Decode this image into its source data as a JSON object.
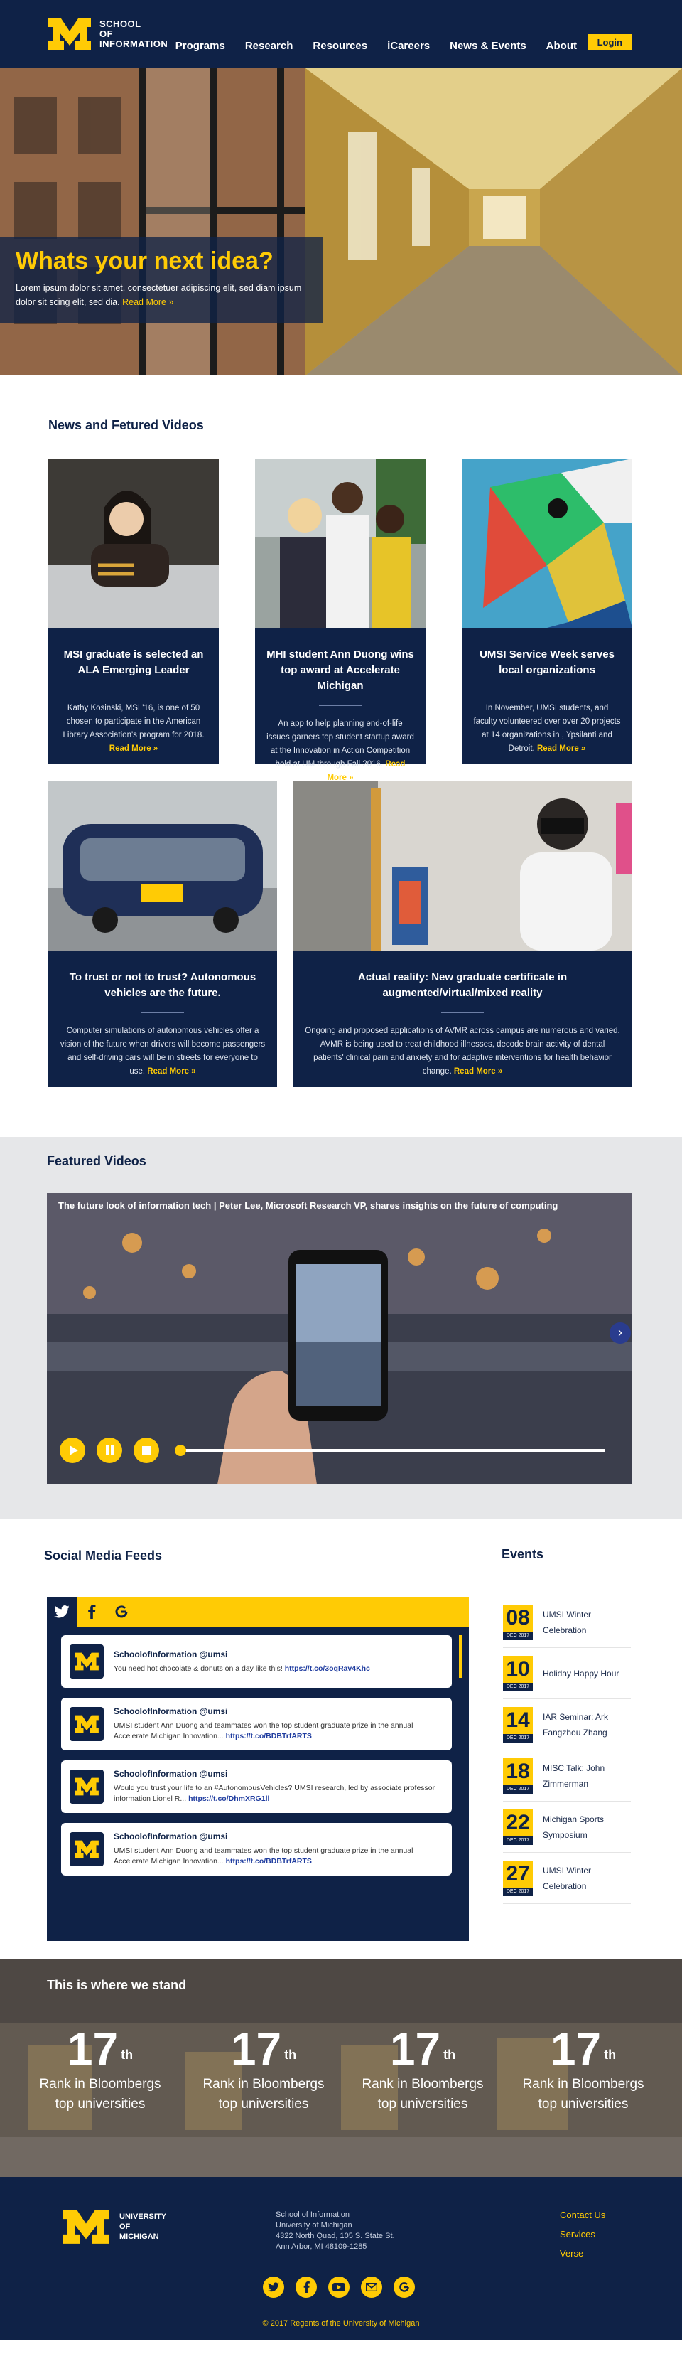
{
  "colors": {
    "navy": "#0f2247",
    "maize": "#ffcb05"
  },
  "brand": {
    "line1": "SCHOOL",
    "line2": "OF",
    "line3": "INFORMATION"
  },
  "nav": {
    "items": [
      "Programs",
      "Research",
      "Resources",
      "iCareers",
      "News & Events",
      "About"
    ],
    "login": "Login"
  },
  "hero": {
    "title": "Whats your next idea?",
    "text": "Lorem ipsum dolor sit amet, consectetuer adipiscing elit, sed diam ipsum dolor sit scing elit, sed dia.",
    "more": "Read More »"
  },
  "news": {
    "heading": "News and Fetured Videos",
    "more": "Read More »",
    "cards": [
      {
        "title": "MSI graduate is selected an ALA Emerging Leader",
        "text": "Kathy Kosinski, MSI '16, is one of 50 chosen to participate in the American Library Association's program for 2018."
      },
      {
        "title": "MHI student Ann Duong wins top award at Accelerate Michigan",
        "text": "An app to help planning end-of-life issues garners top student startup award at the Innovation in Action Competition held at UM through Fall 2016."
      },
      {
        "title": "UMSI Service Week serves local organizations",
        "text": "In November, UMSI students, and faculty volunteered over over 20 projects at 14 organizations in , Ypsilanti and Detroit."
      },
      {
        "title": "To trust or not to trust? Autonomous vehicles are the future.",
        "text": "Computer simulations of autonomous vehicles offer a vision of the future when drivers will become passengers and self-driving cars will be in streets for everyone to use."
      },
      {
        "title": "Actual reality: New graduate certificate in augmented/virtual/mixed reality",
        "text": "Ongoing and proposed applications of AVMR across campus are numerous and varied. AVMR is being used to treat childhood illnesses, decode brain activity of dental patients' clinical pain and anxiety and for adaptive interventions for health behavior change."
      }
    ]
  },
  "videos": {
    "heading": "Featured Videos",
    "title": "The future look of information tech | Peter Lee, Microsoft Research VP, shares insights on the future of computing",
    "progress_fraction": 0.0
  },
  "social": {
    "heading": "Social Media Feeds",
    "tabs": [
      "twitter-icon",
      "facebook-icon",
      "google-icon"
    ],
    "tweets": [
      {
        "user": "SchoolofInformation @umsi",
        "text": "You need hot chocolate & donuts on a day like this!",
        "link": "https://t.co/3oqRav4Khc"
      },
      {
        "user": "SchoolofInformation @umsi",
        "text": "UMSI student Ann Duong and teammates won the top student graduate prize in the annual Accelerate Michigan Innovation...",
        "link": "https://t.co/BDBTrfARTS"
      },
      {
        "user": "SchoolofInformation @umsi",
        "text": "Would you trust your life to an #AutonomousVehicles? UMSI research, led by associate professor information Lionel R...",
        "link": "https://t.co/DhmXRG1ll"
      },
      {
        "user": "SchoolofInformation @umsi",
        "text": "UMSI student Ann Duong and teammates won the top student graduate prize in the annual Accelerate Michigan Innovation...",
        "link": "https://t.co/BDBTrfARTS"
      }
    ]
  },
  "events": {
    "heading": "Events",
    "items": [
      {
        "day": "08",
        "month": "DEC 2017",
        "name": "UMSI Winter Celebration"
      },
      {
        "day": "10",
        "month": "DEC 2017",
        "name": "Holiday Happy Hour"
      },
      {
        "day": "14",
        "month": "DEC 2017",
        "name": "IAR Seminar: Ark Fangzhou Zhang"
      },
      {
        "day": "18",
        "month": "DEC 2017",
        "name": "MISC Talk: John Zimmerman"
      },
      {
        "day": "22",
        "month": "DEC 2017",
        "name": "Michigan Sports Symposium"
      },
      {
        "day": "27",
        "month": "DEC 2017",
        "name": "UMSI Winter Celebration"
      }
    ]
  },
  "stats": {
    "heading": "This is where we stand",
    "items": [
      {
        "num": "17",
        "sup": "th",
        "label1": "Rank in Bloombergs",
        "label2": "top universities"
      },
      {
        "num": "17",
        "sup": "th",
        "label1": "Rank in Bloombergs",
        "label2": "top universities"
      },
      {
        "num": "17",
        "sup": "th",
        "label1": "Rank in Bloombergs",
        "label2": "top universities"
      },
      {
        "num": "17",
        "sup": "th",
        "label1": "Rank in Bloombergs",
        "label2": "top universities"
      }
    ]
  },
  "footer": {
    "brand1": "UNIVERSITY",
    "brand2": "OF",
    "brand3": "MICHIGAN",
    "address": [
      "School of Information",
      "University of Michigan",
      "4322 North Quad, 105 S. State St.",
      "Ann Arbor, MI 48109-1285"
    ],
    "links": [
      "Contact Us",
      "Services",
      "Verse"
    ],
    "social": [
      "twitter-icon",
      "facebook-icon",
      "youtube-icon",
      "email-icon",
      "google-icon"
    ],
    "copyright": "© 2017 Regents of the University of Michigan"
  }
}
